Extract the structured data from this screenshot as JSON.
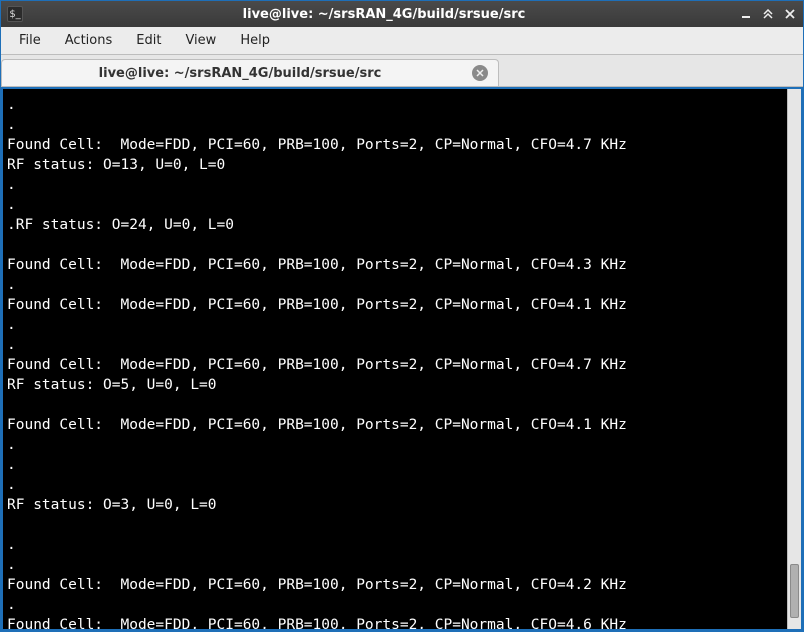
{
  "window": {
    "title": "live@live: ~/srsRAN_4G/build/srsue/src",
    "icon_glyph": "$_"
  },
  "menu": {
    "file": "File",
    "actions": "Actions",
    "edit": "Edit",
    "view": "View",
    "help": "Help"
  },
  "tab": {
    "label": "live@live: ~/srsRAN_4G/build/srsue/src"
  },
  "terminal": {
    "lines": [
      ".",
      ".",
      "Found Cell:  Mode=FDD, PCI=60, PRB=100, Ports=2, CP=Normal, CFO=4.7 KHz",
      "RF status: O=13, U=0, L=0",
      ".",
      ".",
      ".RF status: O=24, U=0, L=0",
      "",
      "Found Cell:  Mode=FDD, PCI=60, PRB=100, Ports=2, CP=Normal, CFO=4.3 KHz",
      ".",
      "Found Cell:  Mode=FDD, PCI=60, PRB=100, Ports=2, CP=Normal, CFO=4.1 KHz",
      ".",
      ".",
      "Found Cell:  Mode=FDD, PCI=60, PRB=100, Ports=2, CP=Normal, CFO=4.7 KHz",
      "RF status: O=5, U=0, L=0",
      "",
      "Found Cell:  Mode=FDD, PCI=60, PRB=100, Ports=2, CP=Normal, CFO=4.1 KHz",
      ".",
      ".",
      ".",
      "RF status: O=3, U=0, L=0",
      "",
      ".",
      ".",
      "Found Cell:  Mode=FDD, PCI=60, PRB=100, Ports=2, CP=Normal, CFO=4.2 KHz",
      ".",
      "Found Cell:  Mode=FDD, PCI=60, PRB=100, Ports=2, CP=Normal, CFO=4.6 KHz"
    ]
  }
}
